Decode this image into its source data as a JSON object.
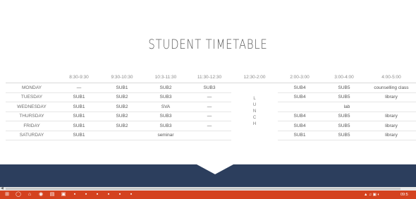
{
  "title": "STUDENT TIMETABLE",
  "header": [
    "",
    "8:30-9:30",
    "9:30-10:30",
    "10:3-11:30",
    "11:30-12:30",
    "12:30-2:00",
    "2:00-3:00",
    "3:00-4:00",
    "4:00-5:00"
  ],
  "lunch": [
    "L",
    "U",
    "N",
    "C",
    "H"
  ],
  "rows": [
    {
      "day": "MONDAY",
      "cells": [
        {
          "t": "—",
          "c": "dark"
        },
        {
          "t": "SUB1",
          "c": "blue"
        },
        {
          "t": "SUB2",
          "c": "pink"
        },
        {
          "t": "SUB3",
          "c": "red"
        },
        {
          "t": "SUB4",
          "c": "red"
        },
        {
          "t": "SUB5",
          "c": "red"
        },
        {
          "t": "counselling class",
          "c": "gray"
        }
      ]
    },
    {
      "day": "TUESDAY",
      "cells": [
        {
          "t": "SUB1",
          "c": "blue"
        },
        {
          "t": "SUB2",
          "c": "red"
        },
        {
          "t": "SUB3",
          "c": "pink"
        },
        {
          "t": "—",
          "c": "dark"
        },
        {
          "t": "SUB4",
          "c": "orange"
        },
        {
          "t": "SUB5",
          "c": "red"
        },
        {
          "t": "library",
          "c": "gray"
        }
      ]
    },
    {
      "day": "WEDNESDAY",
      "cells": [
        {
          "t": "SUB1",
          "c": "pink"
        },
        {
          "t": "SUB2",
          "c": "orange"
        },
        {
          "t": "SVA",
          "c": "red"
        },
        {
          "t": "—",
          "c": "dark"
        },
        {
          "t": "lab",
          "c": "green",
          "span": 3
        }
      ]
    },
    {
      "day": "THURSDAY",
      "cells": [
        {
          "t": "SUB1",
          "c": "gray"
        },
        {
          "t": "SUB2",
          "c": "red"
        },
        {
          "t": "SUB3",
          "c": "orange"
        },
        {
          "t": "—",
          "c": "lgray"
        },
        {
          "t": "SUB4",
          "c": "blue"
        },
        {
          "t": "SUB5",
          "c": "red"
        },
        {
          "t": "library",
          "c": "gray"
        }
      ]
    },
    {
      "day": "FRIDAY",
      "cells": [
        {
          "t": "SUB1",
          "c": "orange"
        },
        {
          "t": "SUB2",
          "c": "red"
        },
        {
          "t": "SUB3",
          "c": "blue"
        },
        {
          "t": "—",
          "c": "lgray"
        },
        {
          "t": "SUB4",
          "c": "pink"
        },
        {
          "t": "SUB5",
          "c": "red"
        },
        {
          "t": "library",
          "c": "gray"
        }
      ]
    },
    {
      "day": "SATURDAY",
      "cells": [
        {
          "t": "SUB1",
          "c": "red"
        },
        {
          "t": "seminar",
          "c": "gray",
          "span": 3
        },
        {
          "t": "SUB1",
          "c": "pink"
        },
        {
          "t": "SUB5",
          "c": "red"
        },
        {
          "t": "library",
          "c": "gray"
        }
      ]
    }
  ],
  "colors": {
    "banner": "#2c3e5d",
    "taskbar": "#d4421f"
  },
  "taskbar": {
    "icons": [
      "windows-start-icon",
      "search-icon",
      "home-icon",
      "chrome-icon",
      "folder-icon",
      "store-icon",
      "app-icon",
      "app-icon",
      "app-icon",
      "app-icon",
      "app-icon",
      "app-icon"
    ],
    "time": "09:5"
  }
}
